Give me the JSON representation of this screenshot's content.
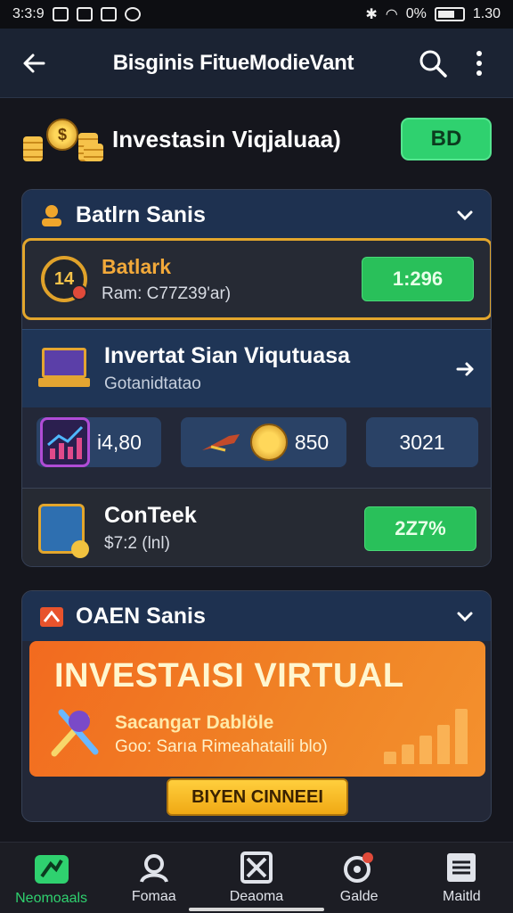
{
  "status_bar": {
    "time": "3:3:9",
    "battery_text": "0%",
    "clock_right": "1.30"
  },
  "app_bar": {
    "title": "Bisginis FitueModieVant"
  },
  "header": {
    "title": "Investasin Viqjaluaa)",
    "button_label": "BD"
  },
  "section1": {
    "title": "Batlrn Sanis",
    "featured": {
      "name": "Batlark",
      "sub": "Ram: C77Z39'ar)",
      "badge_text": "14",
      "value": "1:296"
    },
    "info_row": {
      "title": "Invertat Sian Viqutuasa",
      "sub": "Gotanidtatao"
    },
    "stats": [
      "i4,80",
      "850",
      "3021"
    ],
    "item": {
      "name": "ConTeek",
      "sub": "$7:2 (lnl)",
      "value": "2Z7%"
    }
  },
  "section2": {
    "title": "OAEN Sanis",
    "promo": {
      "headline": "INVESTAISI VIRTUAL",
      "line1": "Sacangaт Dablöle",
      "line2": "Goo: Sarıa Rimeahataili blo)"
    },
    "cta_label": "BIYEN CINNEEI"
  },
  "bottom_nav": [
    {
      "label": "Neomoaals",
      "icon": "home-icon",
      "active": true
    },
    {
      "label": "Fomaa",
      "icon": "user-icon",
      "active": false
    },
    {
      "label": "Deaoma",
      "icon": "close-box-icon",
      "active": false
    },
    {
      "label": "Galde",
      "icon": "notification-icon",
      "active": false
    },
    {
      "label": "Maitld",
      "icon": "menu-icon",
      "active": false
    }
  ],
  "colors": {
    "accent_green": "#2fd16f",
    "gold": "#e3a62c",
    "section_blue": "#1e3150",
    "promo_orange": "#f26a1f"
  }
}
